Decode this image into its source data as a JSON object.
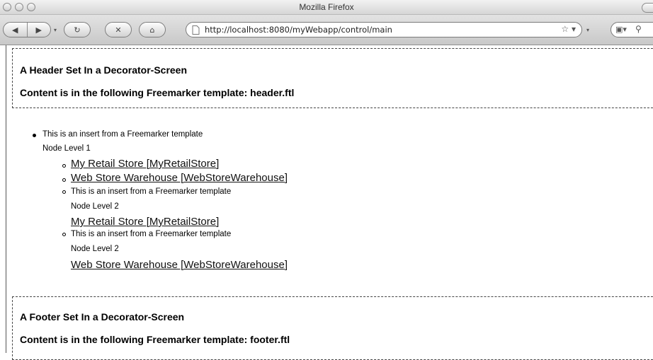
{
  "window": {
    "title": "Mozilla Firefox"
  },
  "toolbar": {
    "url": "http://localhost:8080/myWebapp/control/main",
    "back_icon": "back-arrow-icon",
    "forward_icon": "forward-arrow-icon",
    "reload_icon": "reload-icon",
    "stop_icon": "stop-icon",
    "home_icon": "home-icon"
  },
  "header": {
    "title": "A Header Set In a Decorator-Screen",
    "subtitle": "Content is in the following Freemarker template: header.ftl"
  },
  "tree": {
    "root_text": "This is an insert from a Freemarker template",
    "root_node_level": "Node Level 1",
    "children": [
      {
        "link": "My Retail Store [MyRetailStore]"
      },
      {
        "link": "Web Store Warehouse [WebStoreWarehouse]"
      },
      {
        "text": "This is an insert from a Freemarker template",
        "node_level": "Node Level 2",
        "link": "My Retail Store [MyRetailStore]"
      },
      {
        "text": "This is an insert from a Freemarker template",
        "node_level": "Node Level 2",
        "link": "Web Store Warehouse [WebStoreWarehouse]"
      }
    ]
  },
  "footer": {
    "title": "A Footer Set In a Decorator-Screen",
    "subtitle": "Content is in the following Freemarker template: footer.ftl"
  }
}
